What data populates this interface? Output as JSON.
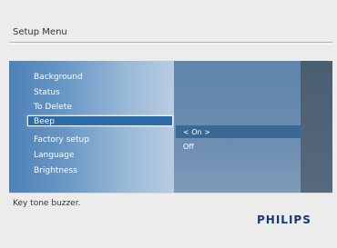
{
  "header": {
    "title": "Setup Menu"
  },
  "menu": {
    "items": [
      {
        "label": "Background"
      },
      {
        "label": "Status"
      },
      {
        "label": "To Delete"
      },
      {
        "label": "Beep"
      },
      {
        "label": "Factory setup"
      },
      {
        "label": "Language"
      },
      {
        "label": "Brightness"
      }
    ],
    "selected_index": 3
  },
  "options": {
    "items": [
      {
        "label": "< On >"
      },
      {
        "label": "Off"
      }
    ],
    "selected_index": 0
  },
  "footer": {
    "description": "Key tone buzzer.",
    "brand": "PHILIPS"
  },
  "colors": {
    "brand": "#153a78",
    "selection": "#2e6ca8",
    "panel_left": "#6a98c6",
    "panel_mid": "#6c8eb1",
    "panel_right": "#4a5e72"
  }
}
